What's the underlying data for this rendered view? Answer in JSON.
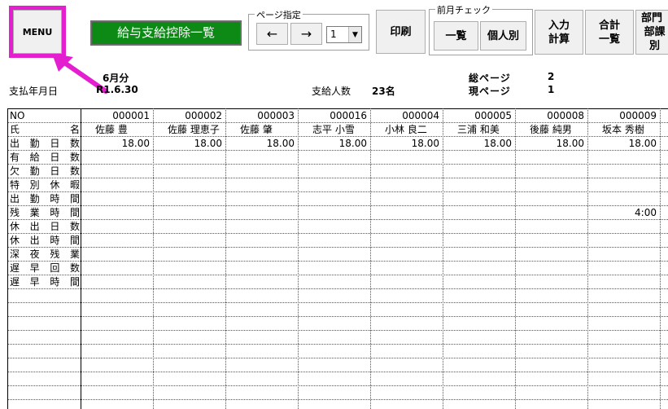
{
  "toolbar": {
    "menu_label": "MENU",
    "list_button": "給与支給控除一覧",
    "page_group_label": "ページ指定",
    "prev_glyph": "←",
    "next_glyph": "→",
    "page_select_value": "1",
    "print_button": "印刷",
    "prev_month_group_label": "前月チェック",
    "list_view_button": "一覧",
    "individual_button": "個人別",
    "input_calc_button_line1": "入力",
    "input_calc_button_line2": "計算",
    "total_list_button_line1": "合計",
    "total_list_button_line2": "一覧",
    "dept_button_line1": "部門",
    "dept_button_line2": "部課別"
  },
  "info": {
    "month": "6月分",
    "pay_date_label": "支払年月日",
    "pay_date_value": "R1.6.30",
    "paid_count_label": "支給人数",
    "paid_count_value": "23名",
    "total_pages_label": "総ページ",
    "total_pages_value": "2",
    "current_page_label": "現ページ",
    "current_page_value": "1"
  },
  "table": {
    "no_label": "NO",
    "name_label_1": "氏",
    "name_label_2": "名",
    "employees": [
      {
        "no": "000001",
        "name": "佐藤 豊"
      },
      {
        "no": "000002",
        "name": "佐藤 理恵子"
      },
      {
        "no": "000003",
        "name": "佐藤 肇"
      },
      {
        "no": "000016",
        "name": "志平 小雪"
      },
      {
        "no": "000004",
        "name": "小林 良二"
      },
      {
        "no": "000005",
        "name": "三浦 和美"
      },
      {
        "no": "000008",
        "name": "後藤 純男"
      },
      {
        "no": "000009",
        "name": "坂本 秀樹"
      }
    ],
    "rows": [
      {
        "label": [
          "出",
          "勤",
          "日",
          "数"
        ],
        "values": [
          "18.00",
          "18.00",
          "18.00",
          "18.00",
          "18.00",
          "18.00",
          "18.00",
          "18.00"
        ]
      },
      {
        "label": [
          "有",
          "給",
          "日",
          "数"
        ],
        "values": [
          "",
          "",
          "",
          "",
          "",
          "",
          "",
          ""
        ]
      },
      {
        "label": [
          "欠",
          "勤",
          "日",
          "数"
        ],
        "values": [
          "",
          "",
          "",
          "",
          "",
          "",
          "",
          ""
        ]
      },
      {
        "label": [
          "特",
          "別",
          "休",
          "暇"
        ],
        "values": [
          "",
          "",
          "",
          "",
          "",
          "",
          "",
          ""
        ]
      },
      {
        "label": [
          "出",
          "勤",
          "時",
          "間"
        ],
        "values": [
          "",
          "",
          "",
          "",
          "",
          "",
          "",
          ""
        ]
      },
      {
        "label": [
          "残",
          "業",
          "時",
          "間"
        ],
        "values": [
          "",
          "",
          "",
          "",
          "",
          "",
          "",
          "4:00"
        ]
      },
      {
        "label": [
          "休",
          "出",
          "日",
          "数"
        ],
        "values": [
          "",
          "",
          "",
          "",
          "",
          "",
          "",
          ""
        ]
      },
      {
        "label": [
          "休",
          "出",
          "時",
          "間"
        ],
        "values": [
          "",
          "",
          "",
          "",
          "",
          "",
          "",
          ""
        ]
      },
      {
        "label": [
          "深",
          "夜",
          "残",
          "業"
        ],
        "values": [
          "",
          "",
          "",
          "",
          "",
          "",
          "",
          ""
        ]
      },
      {
        "label": [
          "遅",
          "早",
          "回",
          "数"
        ],
        "values": [
          "",
          "",
          "",
          "",
          "",
          "",
          "",
          ""
        ]
      },
      {
        "label": [
          "遅",
          "早",
          "時",
          "間"
        ],
        "values": [
          "",
          "",
          "",
          "",
          "",
          "",
          "",
          ""
        ]
      }
    ]
  },
  "colors": {
    "highlight": "#e41fd0",
    "green_button": "#0d8a16"
  }
}
